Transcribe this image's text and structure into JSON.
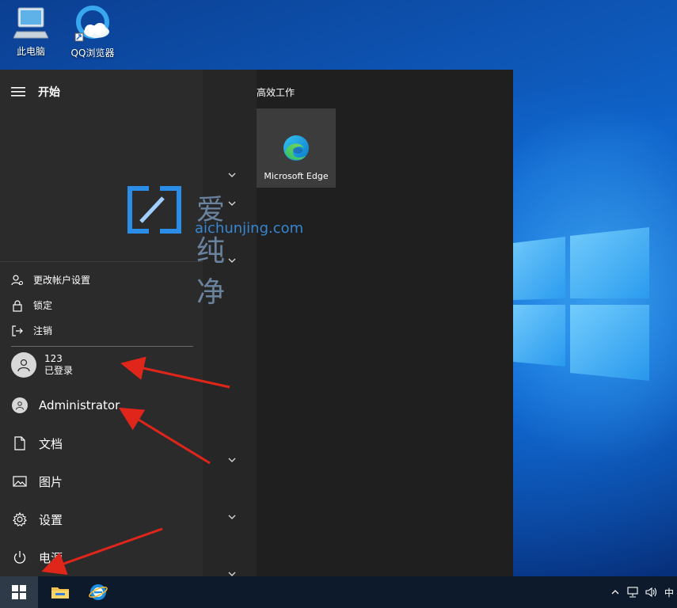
{
  "desktop": {
    "icons": [
      {
        "label": "此电脑",
        "icon": "this-pc-icon"
      },
      {
        "label": "QQ浏览器",
        "icon": "qq-browser-icon"
      }
    ]
  },
  "start_menu": {
    "title": "开始",
    "account_flyout": {
      "items": [
        {
          "label": "更改帐户设置",
          "icon": "account-settings-icon"
        },
        {
          "label": "锁定",
          "icon": "lock-icon"
        },
        {
          "label": "注销",
          "icon": "sign-out-icon"
        }
      ],
      "other_user": {
        "name": "123",
        "status": "已登录"
      }
    },
    "nav": [
      {
        "label": "Administrator",
        "icon": "user-avatar-icon"
      },
      {
        "label": "文档",
        "icon": "document-icon"
      },
      {
        "label": "图片",
        "icon": "pictures-icon"
      },
      {
        "label": "设置",
        "icon": "gear-icon"
      },
      {
        "label": "电源",
        "icon": "power-icon"
      }
    ],
    "tiles_group": {
      "title": "高效工作",
      "tiles": [
        {
          "label": "Microsoft Edge",
          "icon": "edge-icon"
        }
      ]
    }
  },
  "watermark": {
    "cn": "爱纯净",
    "en": "aichunjing.com"
  },
  "taskbar": {
    "apps": [
      "file-explorer-icon",
      "ie-browser-icon"
    ],
    "tray": {
      "ime": "中"
    }
  },
  "colors": {
    "accent_red": "#e0261b",
    "menu_bg": "#2b2b2b",
    "tile_bg": "#3c3c3c"
  }
}
